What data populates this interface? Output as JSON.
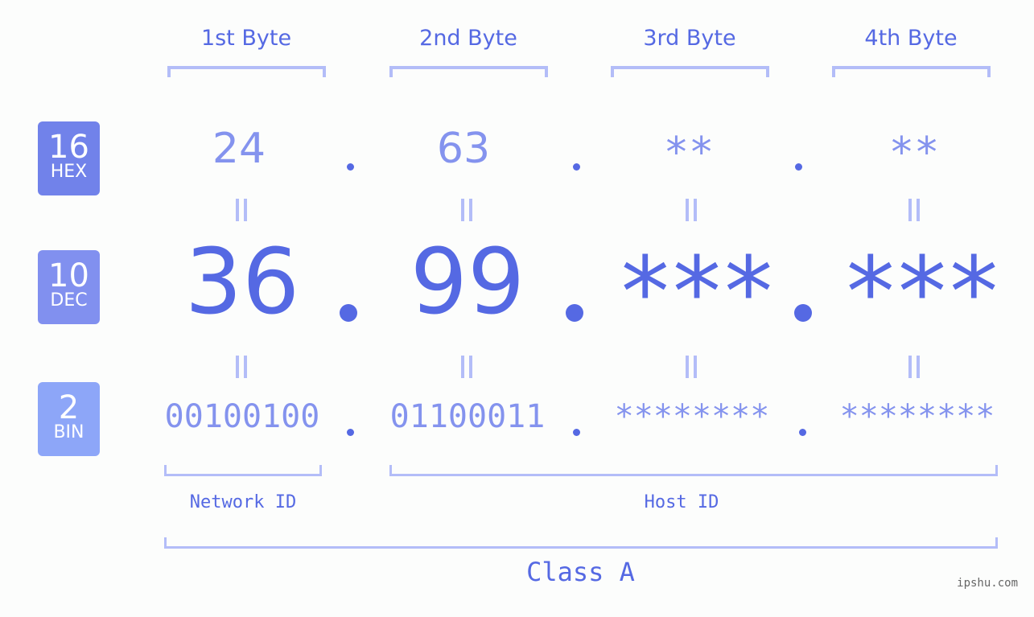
{
  "bytes": [
    {
      "header": "1st Byte",
      "hex": "24",
      "dec": "36",
      "bin": "00100100"
    },
    {
      "header": "2nd Byte",
      "hex": "63",
      "dec": "99",
      "bin": "01100011"
    },
    {
      "header": "3rd Byte",
      "hex": "**",
      "dec": "***",
      "bin": "********"
    },
    {
      "header": "4th Byte",
      "hex": "**",
      "dec": "***",
      "bin": "********"
    }
  ],
  "badges": {
    "hex": {
      "num": "16",
      "label": "HEX",
      "color": "#7182ea"
    },
    "dec": {
      "num": "10",
      "label": "DEC",
      "color": "#8190ef"
    },
    "bin": {
      "num": "2",
      "label": "BIN",
      "color": "#8da6f8"
    }
  },
  "segments": {
    "network": "Network ID",
    "host": "Host ID"
  },
  "class_label": "Class A",
  "watermark": "ipshu.com",
  "colors": {
    "accent": "#5569e3",
    "light": "#8493ee",
    "bracket": "#b3bdf8"
  }
}
